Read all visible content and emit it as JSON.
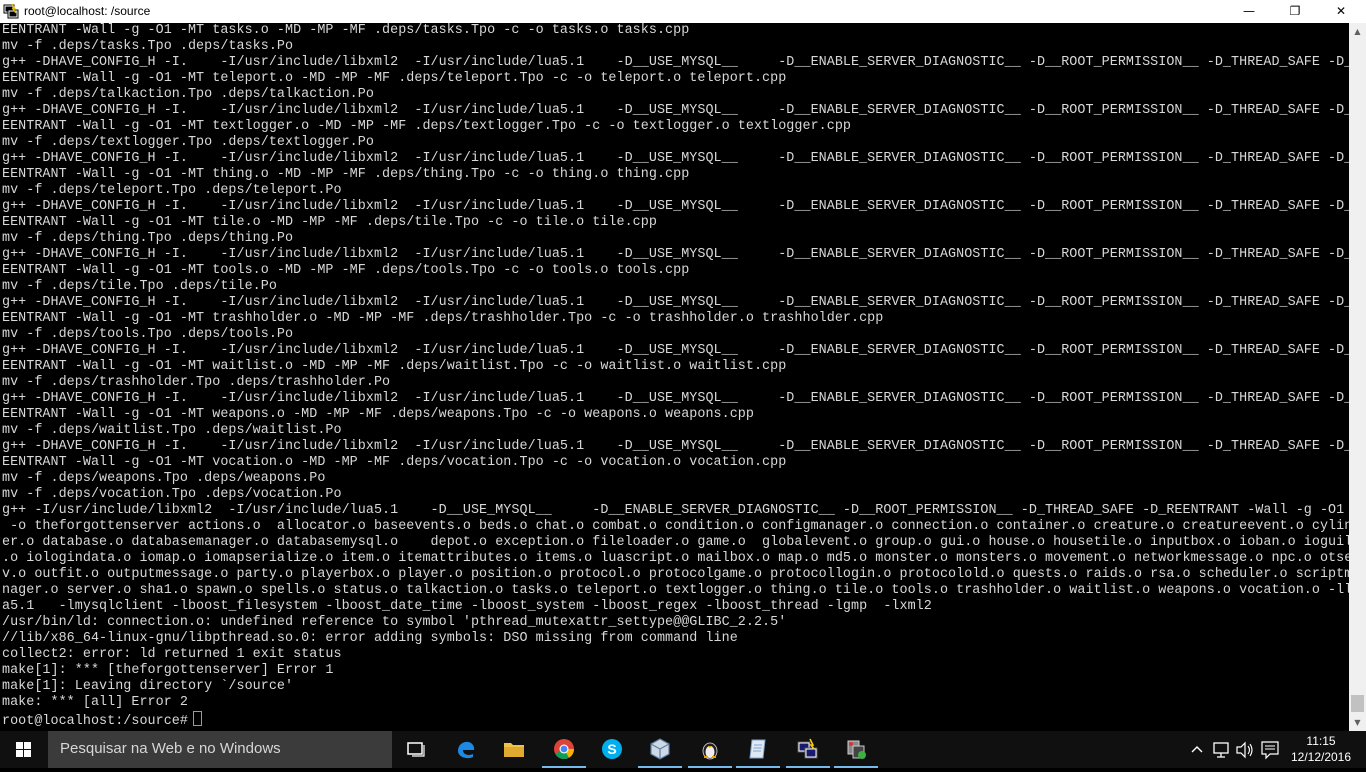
{
  "window": {
    "title": "root@localhost: /source",
    "minimize_glyph": "—",
    "maximize_glyph": "❐",
    "close_glyph": "✕"
  },
  "terminal": {
    "lines": [
      "EENTRANT -Wall -g -O1 -MT tasks.o -MD -MP -MF .deps/tasks.Tpo -c -o tasks.o tasks.cpp",
      "mv -f .deps/tasks.Tpo .deps/tasks.Po",
      "g++ -DHAVE_CONFIG_H -I.    -I/usr/include/libxml2  -I/usr/include/lua5.1    -D__USE_MYSQL__     -D__ENABLE_SERVER_DIAGNOSTIC__ -D__ROOT_PERMISSION__ -D_THREAD_SAFE -D_R",
      "EENTRANT -Wall -g -O1 -MT teleport.o -MD -MP -MF .deps/teleport.Tpo -c -o teleport.o teleport.cpp",
      "mv -f .deps/talkaction.Tpo .deps/talkaction.Po",
      "g++ -DHAVE_CONFIG_H -I.    -I/usr/include/libxml2  -I/usr/include/lua5.1    -D__USE_MYSQL__     -D__ENABLE_SERVER_DIAGNOSTIC__ -D__ROOT_PERMISSION__ -D_THREAD_SAFE -D_R",
      "EENTRANT -Wall -g -O1 -MT textlogger.o -MD -MP -MF .deps/textlogger.Tpo -c -o textlogger.o textlogger.cpp",
      "mv -f .deps/textlogger.Tpo .deps/textlogger.Po",
      "g++ -DHAVE_CONFIG_H -I.    -I/usr/include/libxml2  -I/usr/include/lua5.1    -D__USE_MYSQL__     -D__ENABLE_SERVER_DIAGNOSTIC__ -D__ROOT_PERMISSION__ -D_THREAD_SAFE -D_R",
      "EENTRANT -Wall -g -O1 -MT thing.o -MD -MP -MF .deps/thing.Tpo -c -o thing.o thing.cpp",
      "mv -f .deps/teleport.Tpo .deps/teleport.Po",
      "g++ -DHAVE_CONFIG_H -I.    -I/usr/include/libxml2  -I/usr/include/lua5.1    -D__USE_MYSQL__     -D__ENABLE_SERVER_DIAGNOSTIC__ -D__ROOT_PERMISSION__ -D_THREAD_SAFE -D_R",
      "EENTRANT -Wall -g -O1 -MT tile.o -MD -MP -MF .deps/tile.Tpo -c -o tile.o tile.cpp",
      "mv -f .deps/thing.Tpo .deps/thing.Po",
      "g++ -DHAVE_CONFIG_H -I.    -I/usr/include/libxml2  -I/usr/include/lua5.1    -D__USE_MYSQL__     -D__ENABLE_SERVER_DIAGNOSTIC__ -D__ROOT_PERMISSION__ -D_THREAD_SAFE -D_R",
      "EENTRANT -Wall -g -O1 -MT tools.o -MD -MP -MF .deps/tools.Tpo -c -o tools.o tools.cpp",
      "mv -f .deps/tile.Tpo .deps/tile.Po",
      "g++ -DHAVE_CONFIG_H -I.    -I/usr/include/libxml2  -I/usr/include/lua5.1    -D__USE_MYSQL__     -D__ENABLE_SERVER_DIAGNOSTIC__ -D__ROOT_PERMISSION__ -D_THREAD_SAFE -D_R",
      "EENTRANT -Wall -g -O1 -MT trashholder.o -MD -MP -MF .deps/trashholder.Tpo -c -o trashholder.o trashholder.cpp",
      "mv -f .deps/tools.Tpo .deps/tools.Po",
      "g++ -DHAVE_CONFIG_H -I.    -I/usr/include/libxml2  -I/usr/include/lua5.1    -D__USE_MYSQL__     -D__ENABLE_SERVER_DIAGNOSTIC__ -D__ROOT_PERMISSION__ -D_THREAD_SAFE -D_R",
      "EENTRANT -Wall -g -O1 -MT waitlist.o -MD -MP -MF .deps/waitlist.Tpo -c -o waitlist.o waitlist.cpp",
      "mv -f .deps/trashholder.Tpo .deps/trashholder.Po",
      "g++ -DHAVE_CONFIG_H -I.    -I/usr/include/libxml2  -I/usr/include/lua5.1    -D__USE_MYSQL__     -D__ENABLE_SERVER_DIAGNOSTIC__ -D__ROOT_PERMISSION__ -D_THREAD_SAFE -D_R",
      "EENTRANT -Wall -g -O1 -MT weapons.o -MD -MP -MF .deps/weapons.Tpo -c -o weapons.o weapons.cpp",
      "mv -f .deps/waitlist.Tpo .deps/waitlist.Po",
      "g++ -DHAVE_CONFIG_H -I.    -I/usr/include/libxml2  -I/usr/include/lua5.1    -D__USE_MYSQL__     -D__ENABLE_SERVER_DIAGNOSTIC__ -D__ROOT_PERMISSION__ -D_THREAD_SAFE -D_R",
      "EENTRANT -Wall -g -O1 -MT vocation.o -MD -MP -MF .deps/vocation.Tpo -c -o vocation.o vocation.cpp",
      "mv -f .deps/weapons.Tpo .deps/weapons.Po",
      "mv -f .deps/vocation.Tpo .deps/vocation.Po",
      "g++ -I/usr/include/libxml2  -I/usr/include/lua5.1    -D__USE_MYSQL__     -D__ENABLE_SERVER_DIAGNOSTIC__ -D__ROOT_PERMISSION__ -D_THREAD_SAFE -D_REENTRANT -Wall -g -O1",
      " -o theforgottenserver actions.o  allocator.o baseevents.o beds.o chat.o combat.o condition.o configmanager.o connection.o container.o creature.o creatureevent.o cylind",
      "er.o database.o databasemanager.o databasemysql.o    depot.o exception.o fileloader.o game.o  globalevent.o group.o gui.o house.o housetile.o inputbox.o ioban.o ioguild",
      ".o iologindata.o iomap.o iomapserialize.o item.o itemattributes.o items.o luascript.o mailbox.o map.o md5.o monster.o monsters.o movement.o networkmessage.o npc.o otser",
      "v.o outfit.o outputmessage.o party.o playerbox.o player.o position.o protocol.o protocolgame.o protocollogin.o protocolold.o quests.o raids.o rsa.o scheduler.o scriptma",
      "nager.o server.o sha1.o spawn.o spells.o status.o talkaction.o tasks.o teleport.o textlogger.o thing.o tile.o tools.o trashholder.o waitlist.o weapons.o vocation.o -llu",
      "a5.1   -lmysqlclient -lboost_filesystem -lboost_date_time -lboost_system -lboost_regex -lboost_thread -lgmp  -lxml2",
      "/usr/bin/ld: connection.o: undefined reference to symbol 'pthread_mutexattr_settype@@GLIBC_2.2.5'",
      "//lib/x86_64-linux-gnu/libpthread.so.0: error adding symbols: DSO missing from command line",
      "collect2: error: ld returned 1 exit status",
      "make[1]: *** [theforgottenserver] Error 1",
      "make[1]: Leaving directory `/source'",
      "make: *** [all] Error 2"
    ],
    "prompt": "root@localhost:/source#"
  },
  "taskbar": {
    "search_placeholder": "Pesquisar na Web e no Windows",
    "apps": [
      {
        "icon": "task-view-icon"
      },
      {
        "icon": "edge-icon"
      },
      {
        "icon": "file-explorer-icon"
      },
      {
        "icon": "chrome-icon"
      },
      {
        "icon": "skype-icon"
      },
      {
        "icon": "virtualbox-icon"
      },
      {
        "icon": "penguin-app-icon"
      },
      {
        "icon": "notepad-app-icon"
      },
      {
        "icon": "remote-terminal-icon"
      },
      {
        "icon": "network-tool-icon"
      }
    ],
    "clock": {
      "time": "11:15",
      "date": "12/12/2016"
    }
  },
  "colors": {
    "terminal_bg": "#000000",
    "terminal_fg": "#d8d8d8",
    "cursor": "#3ddc3d",
    "taskbar_bg": "#101010",
    "search_bg": "#3b3b3b",
    "active_indicator": "#76b9ed"
  }
}
